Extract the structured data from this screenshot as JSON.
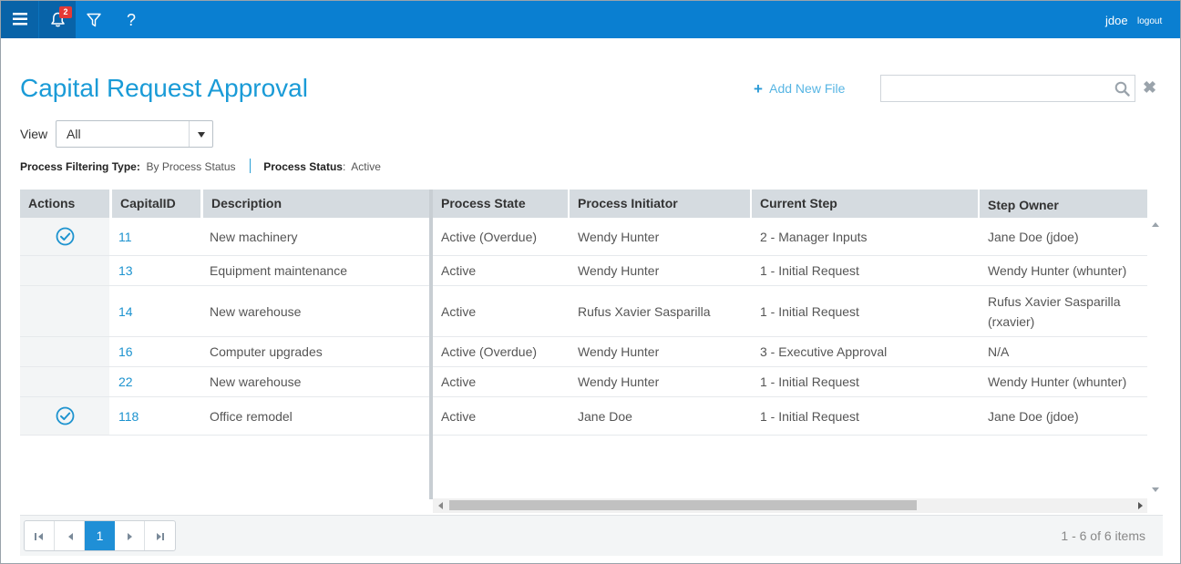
{
  "header": {
    "notification_count": "2",
    "help_label": "?",
    "username": "jdoe",
    "logout_label": "logout"
  },
  "page": {
    "title": "Capital Request Approval",
    "add_file_label": "Add New File",
    "search_value": "",
    "search_placeholder": "",
    "clear_label": "✖"
  },
  "view": {
    "label": "View",
    "selected": "All"
  },
  "filter_info": {
    "type_label": "Process Filtering Type",
    "type_value": "By Process Status",
    "status_label": "Process Status",
    "status_value": "Active"
  },
  "grid": {
    "columns": [
      "Actions",
      "CapitalID",
      "Description",
      "Process State",
      "Process Initiator",
      "Current Step",
      "Step Owner"
    ],
    "rows": [
      {
        "approve": true,
        "id": "11",
        "description": "New machinery",
        "state": "Active (Overdue)",
        "initiator": "Wendy Hunter",
        "step": "2 - Manager Inputs",
        "owner": "Jane Doe (jdoe)"
      },
      {
        "approve": false,
        "id": "13",
        "description": "Equipment maintenance",
        "state": "Active",
        "initiator": "Wendy Hunter",
        "step": "1 - Initial Request",
        "owner": "Wendy Hunter (whunter)"
      },
      {
        "approve": false,
        "id": "14",
        "description": "New warehouse",
        "state": "Active",
        "initiator": "Rufus Xavier Sasparilla",
        "step": "1 - Initial Request",
        "owner": "Rufus Xavier Sasparilla (rxavier)"
      },
      {
        "approve": false,
        "id": "16",
        "description": "Computer upgrades",
        "state": "Active (Overdue)",
        "initiator": "Wendy Hunter",
        "step": "3 - Executive Approval",
        "owner": "N/A"
      },
      {
        "approve": false,
        "id": "22",
        "description": "New warehouse",
        "state": "Active",
        "initiator": "Wendy Hunter",
        "step": "1 - Initial Request",
        "owner": "Wendy Hunter (whunter)"
      },
      {
        "approve": true,
        "id": "118",
        "description": "Office remodel",
        "state": "Active",
        "initiator": "Jane Doe",
        "step": "1 - Initial Request",
        "owner": "Jane Doe (jdoe)"
      }
    ]
  },
  "pager": {
    "current_page": "1",
    "info": "1 - 6 of 6 items"
  },
  "colors": {
    "topbar": "#0a7fd1",
    "accent": "#1a9bd7",
    "header_cell": "#d5dbe0"
  }
}
